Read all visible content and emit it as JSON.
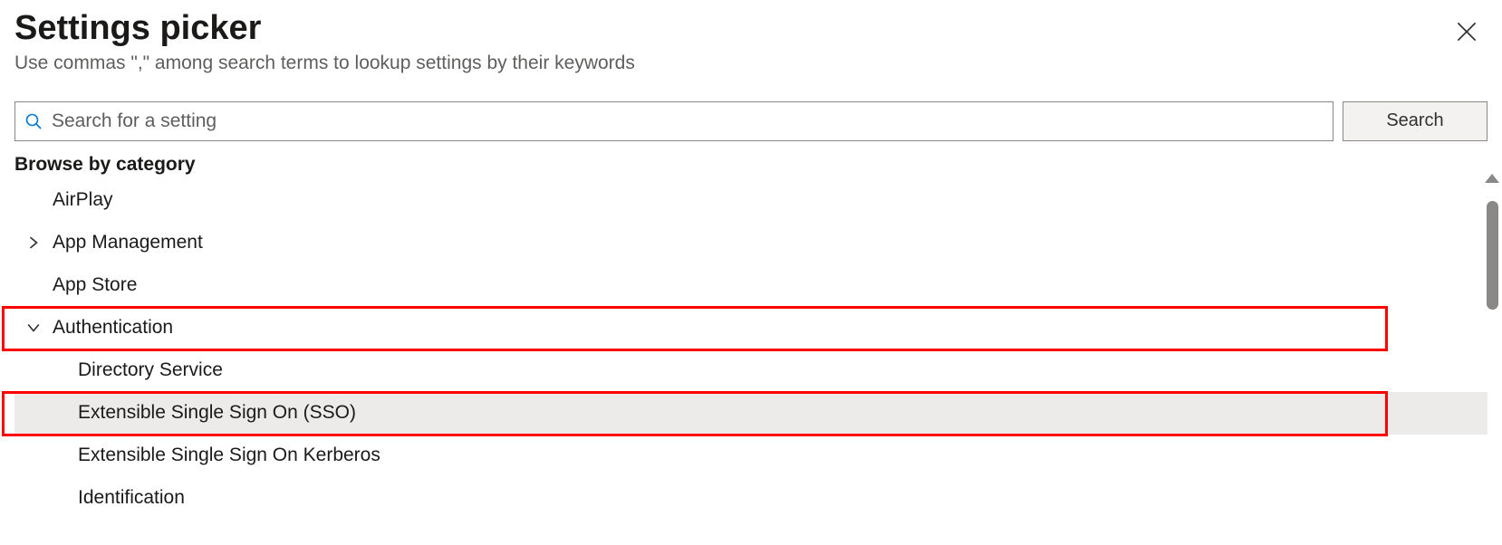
{
  "header": {
    "title": "Settings picker",
    "subtitle": "Use commas \",\" among search terms to lookup settings by their keywords"
  },
  "search": {
    "placeholder": "Search for a setting",
    "button_label": "Search"
  },
  "browse_label": "Browse by category",
  "categories": [
    {
      "label": "AirPlay",
      "expandable": false
    },
    {
      "label": "App Management",
      "expandable": true,
      "expanded": false
    },
    {
      "label": "App Store",
      "expandable": false
    },
    {
      "label": "Authentication",
      "expandable": true,
      "expanded": true,
      "children": [
        {
          "label": "Directory Service",
          "selected": false
        },
        {
          "label": "Extensible Single Sign On (SSO)",
          "selected": true
        },
        {
          "label": "Extensible Single Sign On Kerberos",
          "selected": false
        },
        {
          "label": "Identification",
          "selected": false
        }
      ]
    }
  ],
  "colors": {
    "highlight_border": "#ff0000",
    "search_icon": "#0078d4",
    "body_text": "#323130",
    "muted_text": "#605e5c",
    "selected_bg": "#edebe9"
  }
}
